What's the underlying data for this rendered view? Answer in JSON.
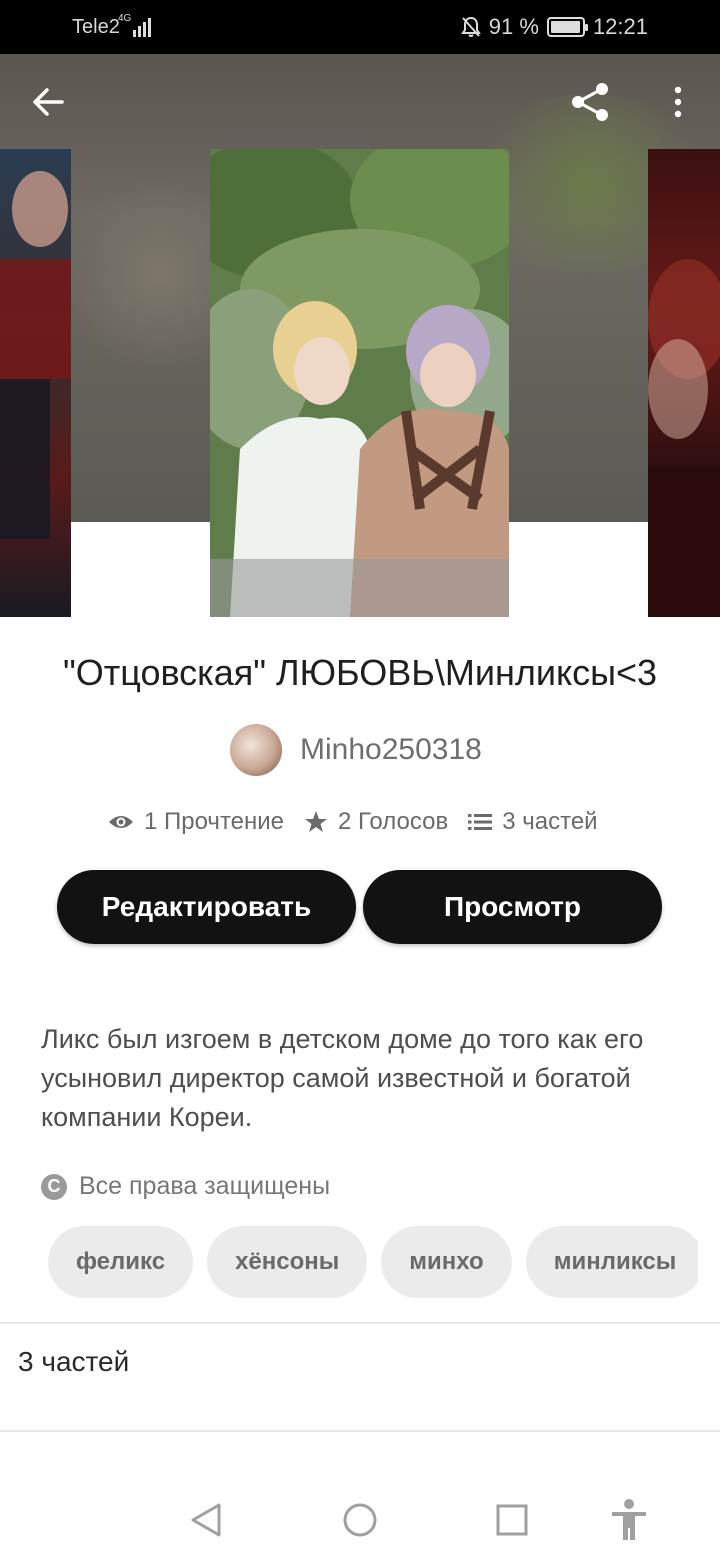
{
  "status_bar": {
    "carrier": "Tele2",
    "network_type": "4G",
    "battery_percent": "91 %",
    "time": "12:21",
    "icons": [
      "signal-icon",
      "mute-bell-icon",
      "battery-icon"
    ]
  },
  "header": {
    "back_icon": "arrow-left-icon",
    "share_icon": "share-icon",
    "menu_icon": "more-vertical-icon"
  },
  "story": {
    "title": "\"Отцовская\" ЛЮБОВЬ\\Минликсы<3",
    "author": "Minho250318",
    "stats": {
      "reads": "1 Прочтение",
      "votes": "2 Голосов",
      "parts": "3 частей"
    },
    "edit_button": "Редактировать",
    "view_button": "Просмотр",
    "description": "Ликс был изгоем в детском доме до того как его усыновил директор самой известной и богатой компании Кореи.",
    "copyright": "Все права защищены",
    "tags": [
      "феликс",
      "хёнсоны",
      "минхо",
      "минликсы"
    ],
    "parts_section_label": "3 частей"
  },
  "nav": {
    "icons": [
      "back-triangle-icon",
      "home-circle-icon",
      "recents-square-icon",
      "accessibility-icon"
    ]
  }
}
